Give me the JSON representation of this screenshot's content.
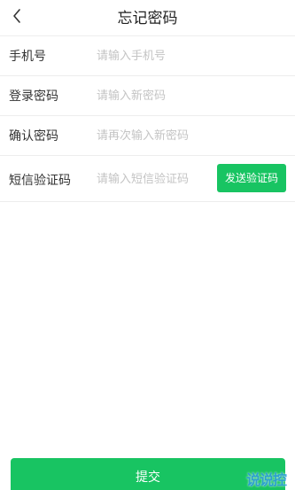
{
  "header": {
    "back_icon": "chevron-left-icon",
    "title": "忘记密码"
  },
  "form": {
    "phone": {
      "label": "手机号",
      "placeholder": "请输入手机号"
    },
    "login_password": {
      "label": "登录密码",
      "placeholder": "请输入新密码"
    },
    "confirm_password": {
      "label": "确认密码",
      "placeholder": "请再次输入新密码"
    },
    "sms_code": {
      "label": "短信验证码",
      "placeholder": "请输入短信验证码",
      "send_button": "发送验证码"
    }
  },
  "submit_label": "提交",
  "watermark": "说说控",
  "colors": {
    "accent": "#18c462",
    "divider": "#ededed",
    "placeholder": "#c4c4c4"
  }
}
